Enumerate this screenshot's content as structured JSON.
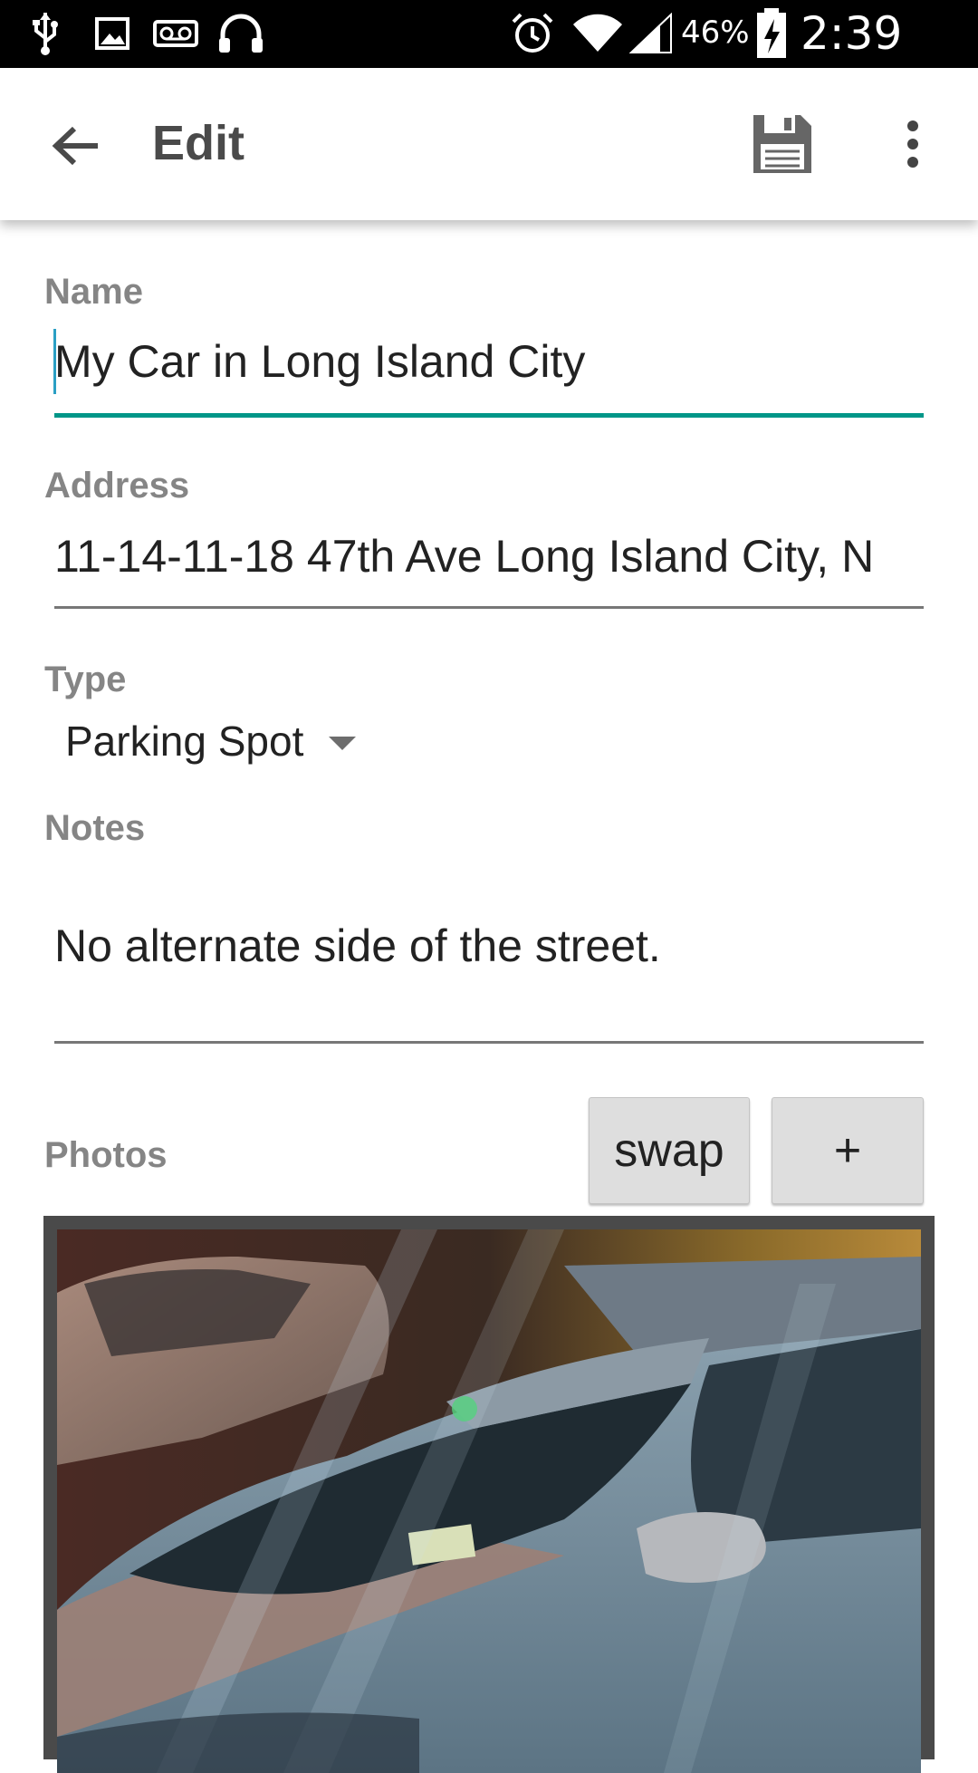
{
  "status_bar": {
    "battery": "46%",
    "time": "2:39 AM",
    "icons": [
      "usb-icon",
      "image-icon",
      "voicemail-icon",
      "headset-icon",
      "alarm-icon",
      "wifi-icon",
      "signal-icon",
      "battery-charging-icon"
    ]
  },
  "appbar": {
    "title": "Edit",
    "icons": [
      "back-arrow-icon",
      "save-icon",
      "overflow-menu-icon"
    ]
  },
  "form": {
    "name_label": "Name",
    "name_value": "My Car in Long Island City",
    "address_label": "Address",
    "address_value": "11-14-11-18 47th Ave Long Island City, N",
    "type_label": "Type",
    "type_value": "Parking Spot",
    "notes_label": "Notes",
    "notes_value": "No alternate side of the street.",
    "photos_label": "Photos",
    "swap_label": "swap",
    "add_label": "+"
  },
  "colors": {
    "accent": "#009688",
    "label": "#858585",
    "button_bg": "#dedede"
  }
}
